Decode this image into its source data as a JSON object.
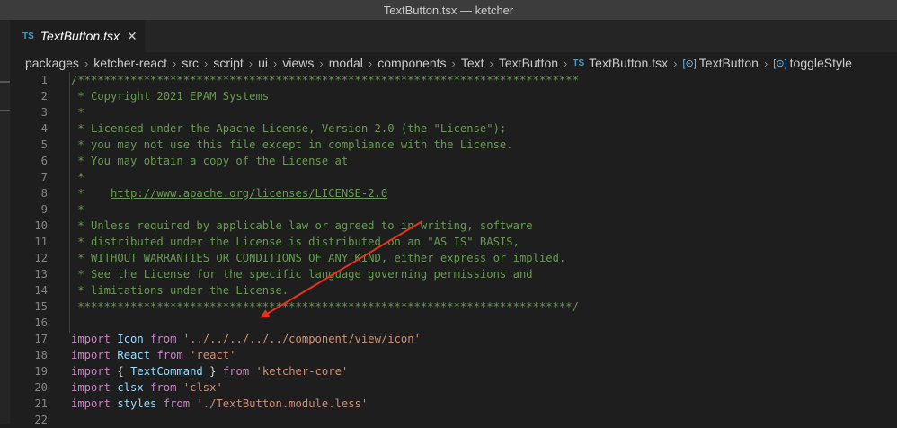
{
  "window": {
    "title": "TextButton.tsx — ketcher"
  },
  "tab": {
    "badge": "TS",
    "title": "TextButton.tsx",
    "close": "✕"
  },
  "breadcrumb": {
    "folders": [
      "packages",
      "ketcher-react",
      "src",
      "script",
      "ui",
      "views",
      "modal",
      "components",
      "Text",
      "TextButton"
    ],
    "file_badge": "TS",
    "file": "TextButton.tsx",
    "symbol_icon": "[⊙]",
    "symbol": "TextButton",
    "member": "toggleStyle",
    "separator": "›"
  },
  "editor": {
    "lines": [
      {
        "n": "1",
        "type": "comment",
        "text": "/****************************************************************************"
      },
      {
        "n": "2",
        "type": "comment",
        "text": " * Copyright 2021 EPAM Systems"
      },
      {
        "n": "3",
        "type": "comment",
        "text": " *"
      },
      {
        "n": "4",
        "type": "comment",
        "text": " * Licensed under the Apache License, Version 2.0 (the \"License\");"
      },
      {
        "n": "5",
        "type": "comment",
        "text": " * you may not use this file except in compliance with the License."
      },
      {
        "n": "6",
        "type": "comment",
        "text": " * You may obtain a copy of the License at"
      },
      {
        "n": "7",
        "type": "comment",
        "text": " *"
      },
      {
        "n": "8",
        "type": "link",
        "prefix": " *    ",
        "link": "http://www.apache.org/licenses/LICENSE-2.0"
      },
      {
        "n": "9",
        "type": "comment",
        "text": " *"
      },
      {
        "n": "10",
        "type": "comment",
        "text": " * Unless required by applicable law or agreed to in writing, software"
      },
      {
        "n": "11",
        "type": "comment",
        "text": " * distributed under the License is distributed on an \"AS IS\" BASIS,"
      },
      {
        "n": "12",
        "type": "comment",
        "text": " * WITHOUT WARRANTIES OR CONDITIONS OF ANY KIND, either express or implied."
      },
      {
        "n": "13",
        "type": "comment",
        "text": " * See the License for the specific language governing permissions and"
      },
      {
        "n": "14",
        "type": "comment",
        "text": " * limitations under the License."
      },
      {
        "n": "15",
        "type": "comment",
        "text": " ***************************************************************************/"
      },
      {
        "n": "16",
        "type": "empty"
      },
      {
        "n": "17",
        "type": "import",
        "kw": "import",
        "name": "Icon",
        "from": "from",
        "src": "'../../../../../component/view/icon'"
      },
      {
        "n": "18",
        "type": "import",
        "kw": "import",
        "name": "React",
        "from": "from",
        "src": "'react'"
      },
      {
        "n": "19",
        "type": "import-braces",
        "kw": "import",
        "open": "{",
        "name": "TextCommand",
        "close": "}",
        "from": "from",
        "src": "'ketcher-core'"
      },
      {
        "n": "20",
        "type": "import",
        "kw": "import",
        "name": "clsx",
        "from": "from",
        "src": "'clsx'"
      },
      {
        "n": "21",
        "type": "import",
        "kw": "import",
        "name": "styles",
        "from": "from",
        "src": "'./TextButton.module.less'"
      },
      {
        "n": "22",
        "type": "empty"
      }
    ]
  },
  "colors": {
    "background": "#1e1e1e",
    "comment": "#6a9955",
    "keyword": "#c586c0",
    "variable": "#9cdcfe",
    "string": "#ce9178",
    "line_number": "#858585",
    "annotation_arrow": "#e8321e"
  }
}
